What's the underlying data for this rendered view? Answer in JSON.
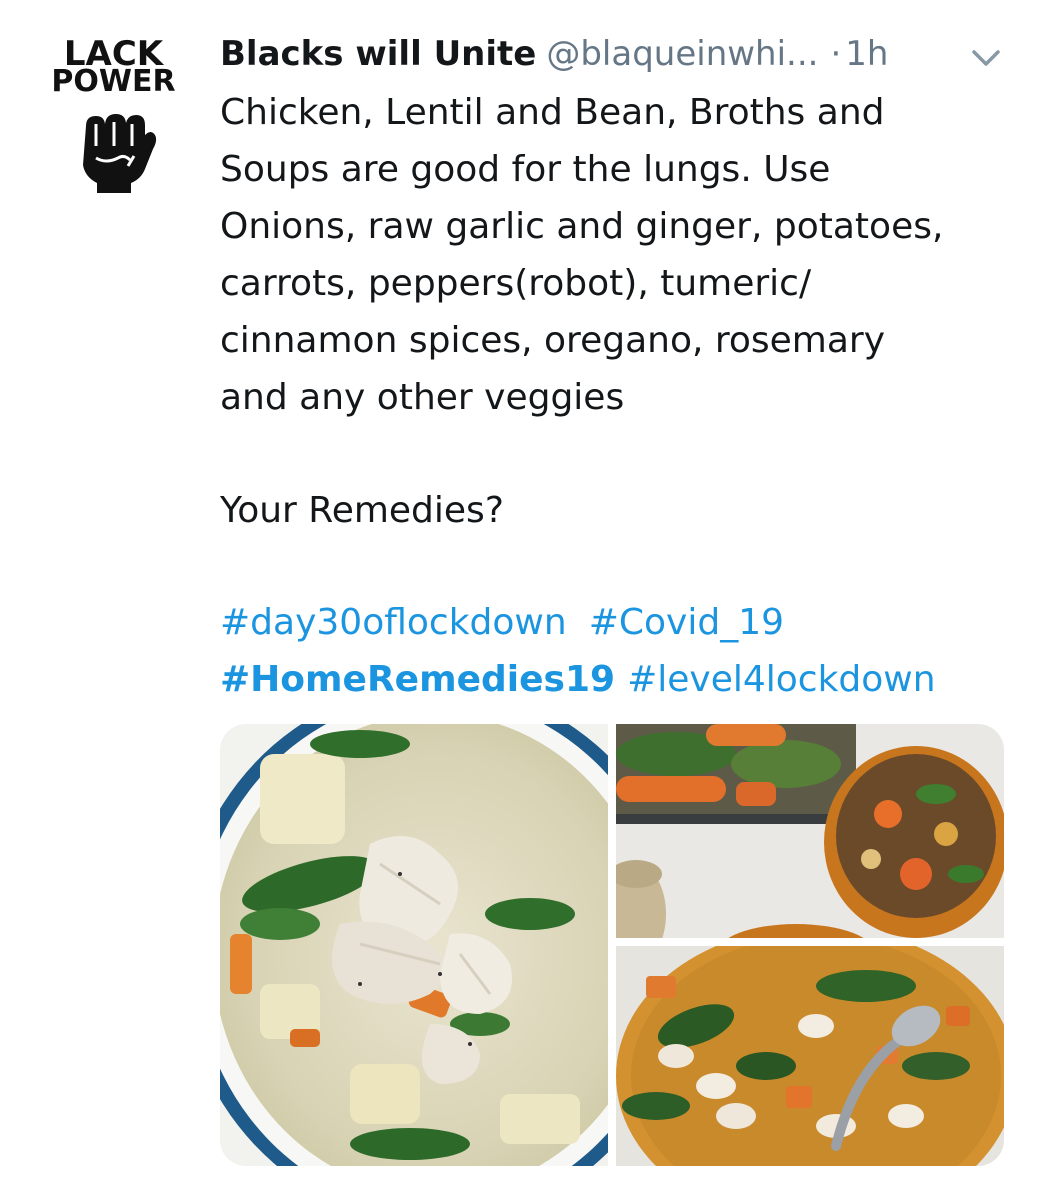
{
  "tweet": {
    "author_name": "Blacks will Unite",
    "author_handle": "@blaqueinwhi...",
    "separator": "·",
    "time": "1h",
    "avatar": {
      "line1": "LACK",
      "line2": "POWER",
      "icon": "raised-fist-icon"
    },
    "menu_icon": "chevron-down-icon",
    "text_lines": [
      "Chicken, Lentil and Bean, Broths and",
      "Soups are good for the lungs. Use",
      "Onions, raw garlic and ginger, potatoes,",
      "carrots, peppers(robot), tumeric/",
      "cinnamon spices, oregano, rosemary",
      "and any other veggies"
    ],
    "question": "Your Remedies?",
    "hashtags": {
      "row1": [
        "#day30oflockdown",
        "#Covid_19"
      ],
      "row2": [
        "#HomeRemedies19",
        "#level4lockdown"
      ]
    },
    "media": {
      "photos": [
        "chicken soup",
        "lentil soup with carrots",
        "bean and spinach soup"
      ]
    }
  },
  "colors": {
    "text": "#14171a",
    "secondary": "#657786",
    "link": "#1b95e0"
  }
}
